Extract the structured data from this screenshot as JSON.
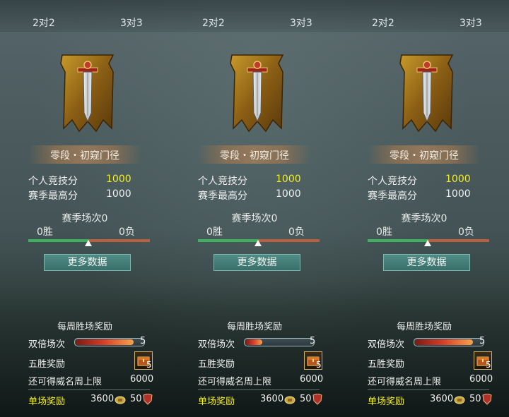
{
  "panels": [
    {
      "tabs": [
        "2对2",
        "3对3"
      ],
      "rank_name": "零段・初窥门径",
      "personal_score_label": "个人竞技分",
      "personal_score": "1000",
      "season_high_label": "赛季最高分",
      "season_high": "1000",
      "season_matches": "赛季场次0",
      "wins": "0胜",
      "losses": "0负",
      "more_button": "更多数据",
      "weekly_title": "每周胜场奖励",
      "double_label": "双倍场次",
      "double_value": "5",
      "double_progress": 0.85,
      "five_win_label": "五胜奖励",
      "five_win_count": "5",
      "cap_label": "还可得威名周上限",
      "cap_value": "6000",
      "single_label": "单场奖励",
      "single_gold": "3600",
      "single_fame": "50"
    },
    {
      "tabs": [
        "2对2",
        "3对3"
      ],
      "rank_name": "零段・初窥门径",
      "personal_score_label": "个人竞技分",
      "personal_score": "1000",
      "season_high_label": "赛季最高分",
      "season_high": "1000",
      "season_matches": "赛季场次0",
      "wins": "0胜",
      "losses": "0负",
      "more_button": "更多数据",
      "weekly_title": "每周胜场奖励",
      "double_label": "双倍场次",
      "double_value": "5",
      "double_progress": 0.25,
      "five_win_label": "五胜奖励",
      "five_win_count": "5",
      "cap_label": "还可得威名周上限",
      "cap_value": "6000",
      "single_label": "单场奖励",
      "single_gold": "3600",
      "single_fame": "50"
    },
    {
      "tabs": [
        "2对2",
        "3对3"
      ],
      "rank_name": "零段・初窥门径",
      "personal_score_label": "个人竞技分",
      "personal_score": "1000",
      "season_high_label": "赛季最高分",
      "season_high": "1000",
      "season_matches": "赛季场次0",
      "wins": "0胜",
      "losses": "0负",
      "more_button": "更多数据",
      "weekly_title": "每周胜场奖励",
      "double_label": "双倍场次",
      "double_value": "5",
      "double_progress": 0.85,
      "five_win_label": "五胜奖励",
      "five_win_count": "5",
      "cap_label": "还可得威名周上限",
      "cap_value": "6000",
      "single_label": "单场奖励",
      "single_gold": "3600",
      "single_fame": "50"
    }
  ],
  "colors": {
    "score_highlight": "#f2ee2a",
    "win_bar": "#3fb060",
    "loss_bar": "#b86040",
    "button": "#3a6f6a"
  },
  "icons": [
    "sword-banner-icon",
    "win-marker-icon",
    "reward-chest-icon",
    "gold-coin-icon",
    "fame-shield-icon"
  ]
}
